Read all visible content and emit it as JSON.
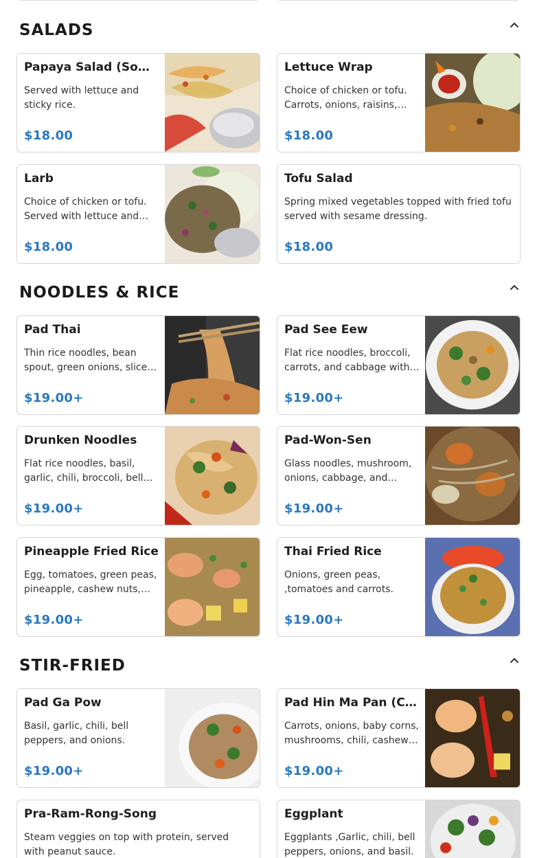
{
  "sections": [
    {
      "title": "SALADS",
      "items": [
        {
          "name": "Papaya Salad (Som Tum)",
          "desc": "Served with lettuce and sticky rice.",
          "price": "$18.00",
          "image": "papaya-salad-photo"
        },
        {
          "name": "Lettuce Wrap",
          "desc": "Choice of chicken or tofu. Carrots, onions, raisins, cashew nuts.",
          "price": "$18.00",
          "image": "lettuce-wrap-photo"
        },
        {
          "name": "Larb",
          "desc": "Choice of chicken or tofu. Served with lettuce and sticky rice.",
          "price": "$18.00",
          "image": "larb-photo"
        },
        {
          "name": "Tofu Salad",
          "desc": "Spring mixed vegetables topped with fried tofu served with sesame dressing.",
          "price": "$18.00",
          "image": ""
        }
      ]
    },
    {
      "title": "NOODLES & RICE",
      "items": [
        {
          "name": "Pad Thai",
          "desc": "Thin rice noodles, bean spout, green onions, sliced peanuts.",
          "price": "$19.00+",
          "image": "pad-thai-photo"
        },
        {
          "name": "Pad See Eew",
          "desc": "Flat rice noodles, broccoli, carrots, and cabbage with egg.",
          "price": "$19.00+",
          "image": "pad-see-eew-photo"
        },
        {
          "name": "Drunken Noodles",
          "desc": "Flat rice noodles, basil, garlic, chili, broccoli, bell peppers.",
          "price": "$19.00+",
          "image": "drunken-noodles-photo"
        },
        {
          "name": "Pad-Won-Sen",
          "desc": "Glass noodles, mushroom, onions, cabbage, and carrots.",
          "price": "$19.00+",
          "image": "pad-won-sen-photo"
        },
        {
          "name": "Pineapple Fried Rice",
          "desc": "Egg, tomatoes, green peas, pineapple, cashew nuts, raisins.",
          "price": "$19.00+",
          "image": "pineapple-fried-rice-photo"
        },
        {
          "name": "Thai Fried Rice",
          "desc": "Onions, green peas, ,tomatoes and carrots.",
          "price": "$19.00+",
          "image": "thai-fried-rice-photo"
        }
      ]
    },
    {
      "title": "STIR-FRIED",
      "items": [
        {
          "name": "Pad Ga Pow",
          "desc": "Basil, garlic, chili, bell peppers, and onions.",
          "price": "$19.00+",
          "image": "pad-ga-pow-photo"
        },
        {
          "name": "Pad Hin Ma Pan (Cashew)",
          "desc": "Carrots, onions, baby corns, mushrooms, chili, cashew nuts.",
          "price": "$19.00+",
          "image": "pad-hin-ma-pan-photo"
        },
        {
          "name": "Pra-Ram-Rong-Song",
          "desc": "Steam veggies on top with protein, served with peanut sauce.",
          "price": "",
          "image": ""
        },
        {
          "name": "Eggplant",
          "desc": "Eggplants ,Garlic, chili, bell peppers, onions, and basil.",
          "price": "",
          "image": "eggplant-photo"
        }
      ]
    }
  ],
  "icons": {
    "collapse": "chevron-up-icon"
  },
  "colors": {
    "price": "#2878c4",
    "border": "#d6d6d6",
    "title": "#1a1a1a"
  }
}
